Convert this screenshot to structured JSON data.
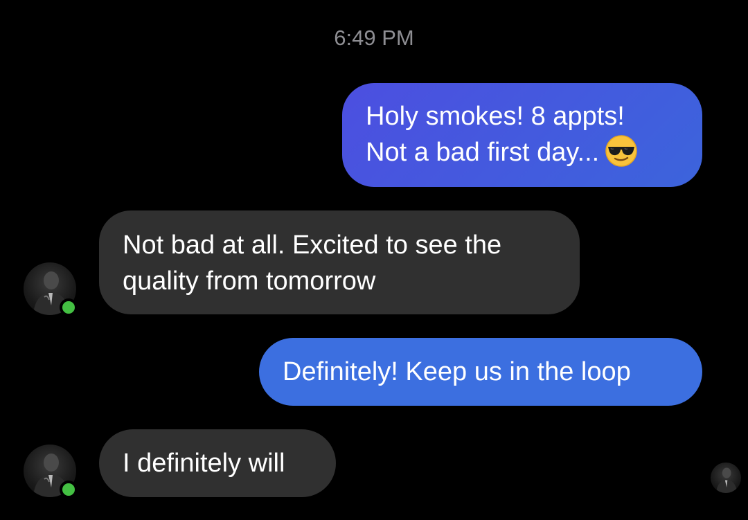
{
  "conversation": {
    "timestamp": "6:49 PM",
    "messages": [
      {
        "sender": "me",
        "lines": [
          "Holy smokes! 8 appts!",
          "Not a bad first day..."
        ],
        "emoji": "smiling-face-with-sunglasses",
        "color": "#4c5ae0"
      },
      {
        "sender": "contact",
        "lines": [
          "Not bad at all. Excited to see the",
          "quality from tomorrow"
        ],
        "color": "#303030"
      },
      {
        "sender": "me",
        "lines": [
          "Definitely! Keep us in the loop"
        ],
        "color": "#3c6fe0"
      },
      {
        "sender": "contact",
        "lines": [
          "I definitely will"
        ],
        "color": "#303030"
      }
    ],
    "presence_color": "#44c043"
  }
}
